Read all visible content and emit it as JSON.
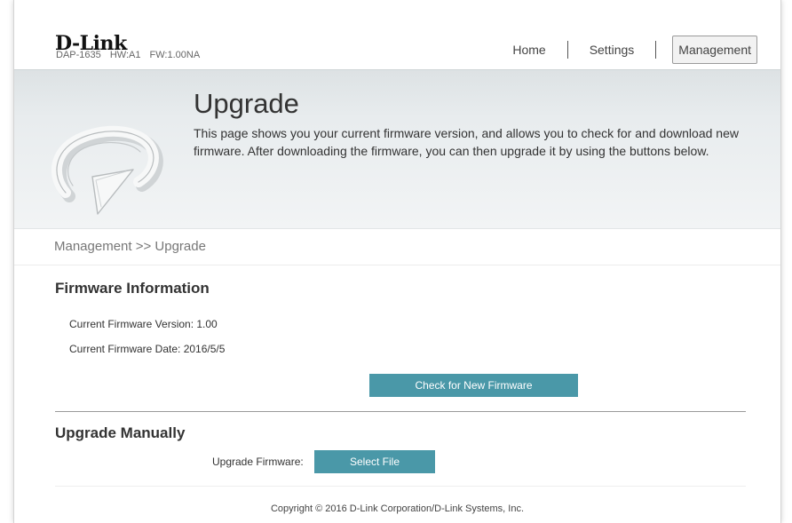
{
  "header": {
    "logo": "D-Link",
    "model": "DAP-1635",
    "hardware": "HW:A1",
    "firmware": "FW:1.00NA",
    "nav": [
      {
        "label": "Home"
      },
      {
        "label": "Settings"
      },
      {
        "label": "Management",
        "active": true
      }
    ]
  },
  "banner": {
    "icon": "upgrade-arrow-icon",
    "title": "Upgrade",
    "description": "This page shows you your current firmware version, and allows you to check for and download new firmware. After downloading the firmware, you can then upgrade it by using the buttons below."
  },
  "breadcrumb": "Management >> Upgrade",
  "firmware_info": {
    "title": "Firmware Information",
    "version_label": "Current Firmware Version: 1.00",
    "date_label": "Current Firmware Date: 2016/5/5",
    "check_button": "Check for New Firmware"
  },
  "upgrade_manually": {
    "title": "Upgrade Manually",
    "field_label": "Upgrade Firmware:",
    "select_button": "Select File"
  },
  "footer": {
    "copyright": "Copyright © 2016 D-Link Corporation/D-Link Systems, Inc."
  },
  "colors": {
    "accent": "#4a98a8",
    "banner": "#e8ecee"
  }
}
